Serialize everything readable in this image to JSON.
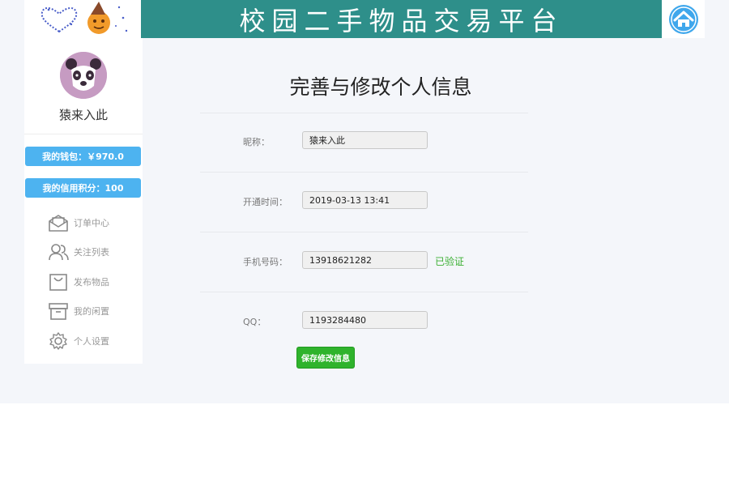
{
  "header": {
    "site_title": "校园二手物品交易平台"
  },
  "sidebar": {
    "username": "猿来入此",
    "wallet_label": "我的钱包：￥970.0",
    "credit_label": "我的信用积分：100",
    "menu": [
      {
        "label": "订单中心",
        "icon": "envelope-open-icon"
      },
      {
        "label": "关注列表",
        "icon": "users-icon"
      },
      {
        "label": "发布物品",
        "icon": "shopping-bag-icon"
      },
      {
        "label": "我的闲置",
        "icon": "archive-box-icon"
      },
      {
        "label": "个人设置",
        "icon": "gear-icon"
      }
    ]
  },
  "main": {
    "title": "完善与修改个人信息",
    "fields": [
      {
        "label": "昵称：",
        "value": "猿来入此"
      },
      {
        "label": "开通时间：",
        "value": "2019-03-13 13:41"
      },
      {
        "label": "手机号码：",
        "value": "13918621282"
      },
      {
        "label": "QQ：",
        "value": "1193284480"
      }
    ],
    "phone_status": "已验证",
    "save_label": "保存修改信息"
  },
  "colors": {
    "banner": "#2e8f8a",
    "accent_blue": "#4db3f0",
    "accent_green": "#2fb32c",
    "background": "#f4f6fa"
  }
}
